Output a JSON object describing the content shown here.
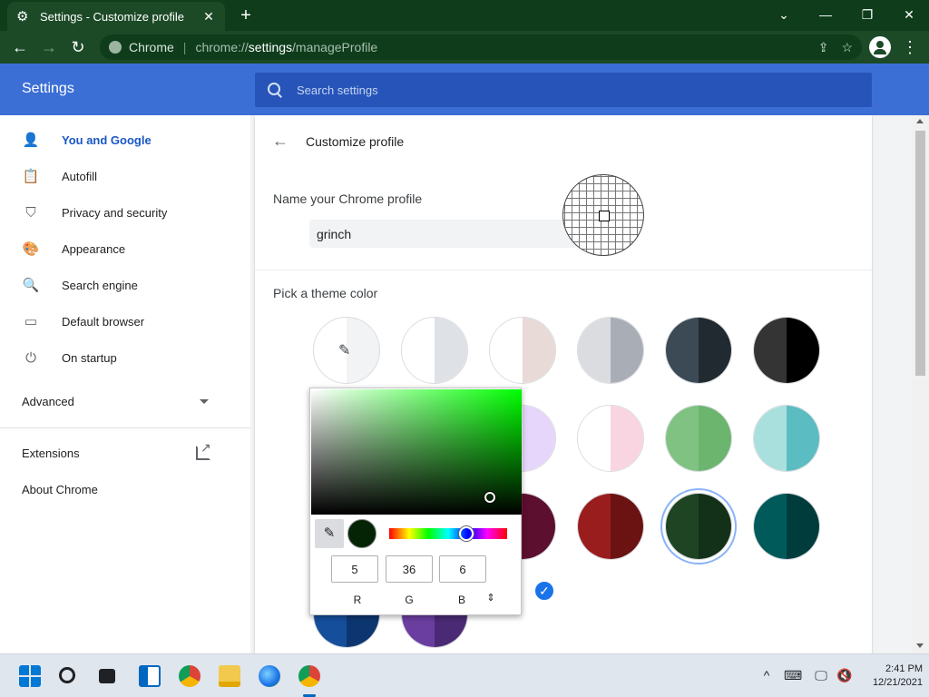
{
  "window": {
    "tab_title": "Settings - Customize profile",
    "new_tab": "+",
    "close_tab": "✕",
    "minimize": "⌄",
    "restore": "—",
    "maximize": "❐",
    "close": "✕"
  },
  "toolbar": {
    "site_name": "Chrome",
    "url_scheme": "chrome://",
    "url_host": "settings",
    "url_path": "/manageProfile"
  },
  "header": {
    "title": "Settings",
    "search_placeholder": "Search settings"
  },
  "sidebar": {
    "items": [
      {
        "label": "You and Google",
        "icon": "person-icon",
        "active": true
      },
      {
        "label": "Autofill",
        "icon": "clipboard-icon"
      },
      {
        "label": "Privacy and security",
        "icon": "shield-icon"
      },
      {
        "label": "Appearance",
        "icon": "palette-icon"
      },
      {
        "label": "Search engine",
        "icon": "search-icon"
      },
      {
        "label": "Default browser",
        "icon": "browser-window-icon"
      },
      {
        "label": "On startup",
        "icon": "power-icon"
      }
    ],
    "advanced": "Advanced",
    "extensions": "Extensions",
    "about": "About Chrome"
  },
  "main": {
    "page_title": "Customize profile",
    "name_label": "Name your Chrome profile",
    "name_value": "grinch",
    "theme_label": "Pick a theme color",
    "swatches": [
      {
        "left": "#ffffff",
        "right": "#dee1e6"
      },
      {
        "left": "#ffffff",
        "right": "#e8dad7"
      },
      {
        "left": "#dadce0",
        "right": "#a9aeb6"
      },
      {
        "left": "#3c4a55",
        "right": "#202a30"
      },
      {
        "left": "#343434",
        "right": "#000000"
      },
      {
        "left": "#d2ebd0",
        "right": "#c5e3c2"
      },
      {
        "left": "#ffffff",
        "right": "#b2e7f1"
      },
      {
        "left": "#ffffff",
        "right": "#e6d6fb"
      },
      {
        "left": "#ffffff",
        "right": "#f8d5e0"
      },
      {
        "left": "#7fc282",
        "right": "#6bb56f"
      },
      {
        "left": "#a9dfdd",
        "right": "#5bbcc1"
      },
      {
        "left": "#c6d8f7",
        "right": "#8aaee8"
      },
      {
        "left": "#fcd9e0",
        "right": "#f9a9b8"
      },
      {
        "left": "#8a1847",
        "right": "#5c0f2f"
      },
      {
        "left": "#9a1d1d",
        "right": "#6b1212"
      },
      {
        "left": "#1f4423",
        "right": "#133018"
      },
      {
        "left": "#005a5a",
        "right": "#003c3c"
      },
      {
        "left": "#154f9c",
        "right": "#0d3670"
      },
      {
        "left": "#6a3ea0",
        "right": "#4a2a74"
      }
    ],
    "selected_index": 15,
    "check_glyph": "✓"
  },
  "color_picker": {
    "r": "5",
    "g": "36",
    "b": "6",
    "r_label": "R",
    "g_label": "G",
    "b_label": "B",
    "format_toggle": "⇕",
    "preview_color": "#052406",
    "hue_position": 0.65,
    "saturation": 0.85,
    "value": 0.14,
    "eyedropper_glyph": "🖉"
  },
  "taskbar": {
    "time": "2:41 PM",
    "date": "12/21/2021"
  }
}
